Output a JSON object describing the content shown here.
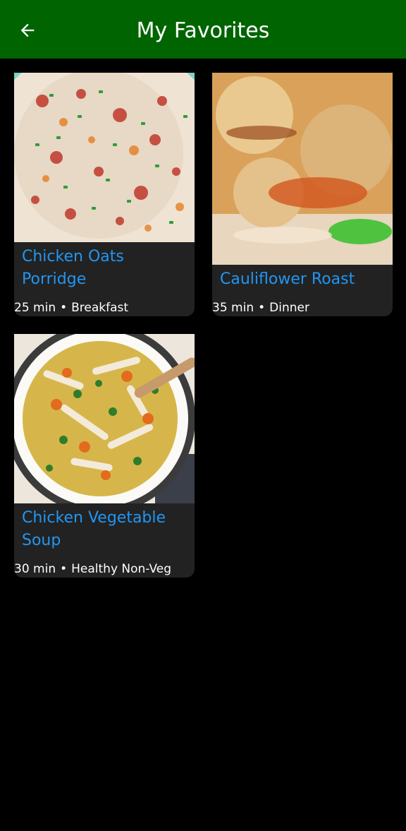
{
  "header": {
    "title": "My Favorites",
    "back_icon": "arrow-left-icon",
    "background": "#006400"
  },
  "favorites": [
    {
      "image_icon": "porridge-photo",
      "title": "Chicken Oats Porridge",
      "time": "25 min",
      "separator": "•",
      "category": "Breakfast"
    },
    {
      "image_icon": "cauliflower-photo",
      "title": "Cauliflower Roast",
      "time": "35 min",
      "separator": "•",
      "category": "Dinner"
    },
    {
      "image_icon": "soup-photo",
      "title": "Chicken Vegetable Soup",
      "time": "30 min",
      "separator": "•",
      "category": "Healthy Non-Veg"
    }
  ],
  "colors": {
    "title_accent": "#2196F3",
    "card_background": "#222222",
    "page_background": "#000000"
  }
}
